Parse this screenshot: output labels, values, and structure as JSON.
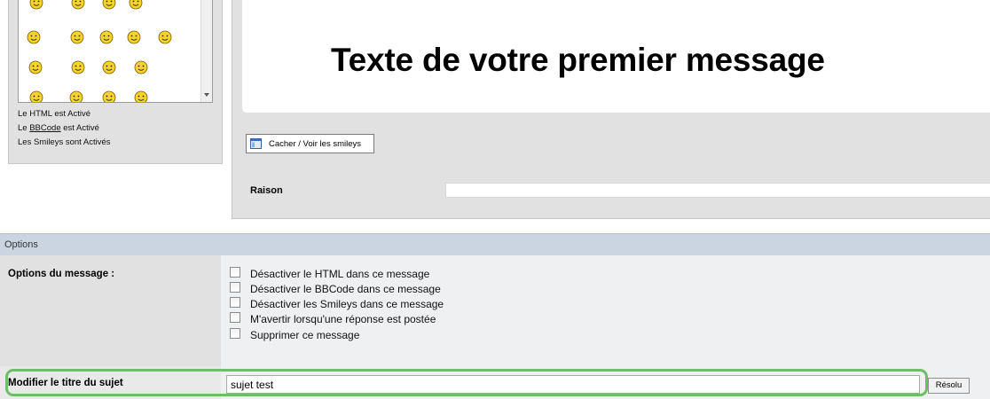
{
  "sidebar": {
    "smileys": [
      {
        "name": "sleepy-smiley"
      },
      {
        "name": "angel-smiley"
      },
      {
        "name": "smile-smiley"
      },
      {
        "name": "happy-smiley"
      },
      {
        "name": "sleeping-smiley"
      },
      {
        "name": "sun-smiley"
      },
      {
        "name": "bunny-smiley"
      },
      {
        "name": "cherry-smiley"
      },
      {
        "name": "santa-smiley"
      },
      {
        "name": "reindeer-smiley"
      },
      {
        "name": "pharaoh-smiley"
      },
      {
        "name": "sun-crown-smiley"
      },
      {
        "name": "king-smiley"
      },
      {
        "name": "jester-smiley"
      },
      {
        "name": "viking-smiley"
      },
      {
        "name": "banana-smiley"
      },
      {
        "name": "smile-smiley"
      }
    ],
    "html_status": "Le HTML est Activé",
    "bbcode_prefix": "Le ",
    "bbcode_link": "BBCode",
    "bbcode_suffix": " est Activé",
    "smileys_status": "Les Smileys sont Activés"
  },
  "editor": {
    "message_text": "Texte de votre premier message",
    "toggle_smileys_label": "Cacher / Voir les smileys",
    "raison_label": "Raison",
    "raison_value": ""
  },
  "options": {
    "header": "Options",
    "message_options_label": "Options du message :",
    "checkboxes": [
      {
        "label": "Désactiver le HTML dans ce message",
        "checked": false
      },
      {
        "label": "Désactiver le BBCode dans ce message",
        "checked": false
      },
      {
        "label": "Désactiver les Smileys dans ce message",
        "checked": false
      },
      {
        "label": "M'avertir lorsqu'une réponse est postée",
        "checked": false
      },
      {
        "label": "Supprimer ce message",
        "checked": false
      }
    ],
    "title_label": "Modifier le titre du sujet",
    "title_value": "sujet test",
    "resolved_button": "Résolu"
  },
  "colors": {
    "options_header_bg": "#cbd5e2",
    "highlight": "#6cbf66",
    "panel_bg": "#e1e1e1"
  }
}
